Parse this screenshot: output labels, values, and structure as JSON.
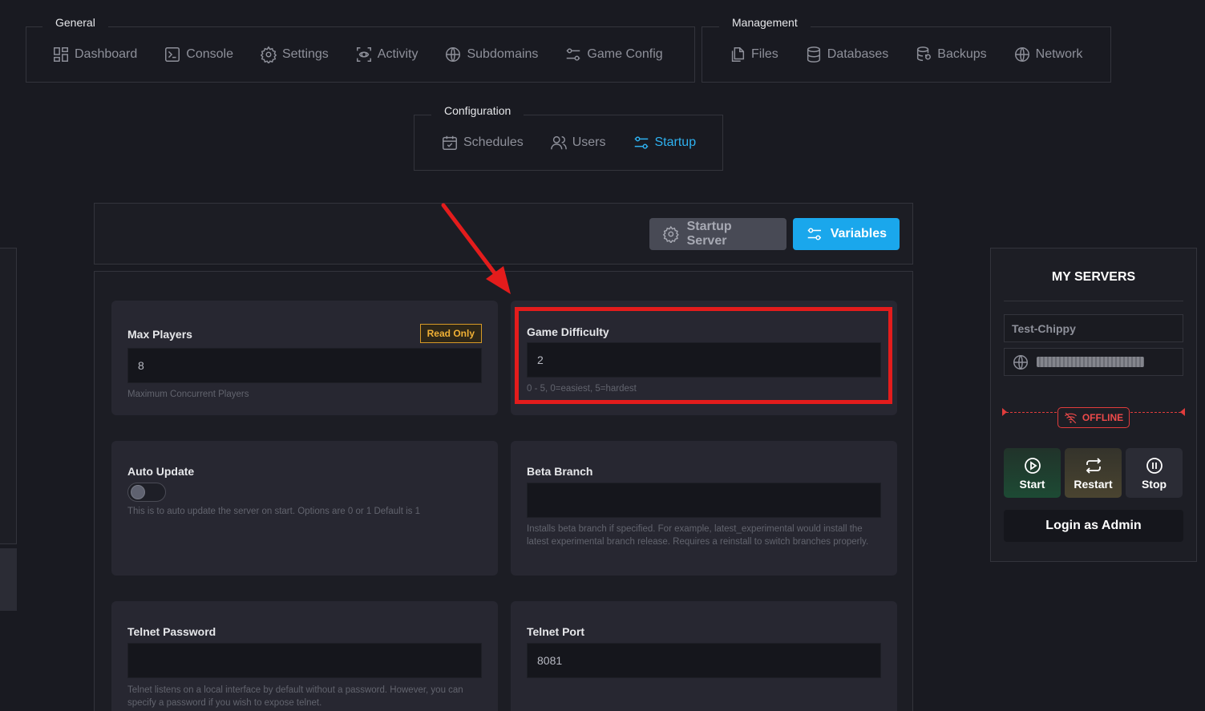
{
  "nav": {
    "general": {
      "legend": "General",
      "items": [
        {
          "label": "Dashboard",
          "icon": "dashboard-icon"
        },
        {
          "label": "Console",
          "icon": "console-icon"
        },
        {
          "label": "Settings",
          "icon": "gear-icon"
        },
        {
          "label": "Activity",
          "icon": "activity-icon"
        },
        {
          "label": "Subdomains",
          "icon": "globe-icon"
        },
        {
          "label": "Game Config",
          "icon": "sliders-icon"
        }
      ]
    },
    "management": {
      "legend": "Management",
      "items": [
        {
          "label": "Files",
          "icon": "files-icon"
        },
        {
          "label": "Databases",
          "icon": "database-icon"
        },
        {
          "label": "Backups",
          "icon": "backup-icon"
        },
        {
          "label": "Network",
          "icon": "globe-icon"
        }
      ]
    },
    "configuration": {
      "legend": "Configuration",
      "items": [
        {
          "label": "Schedules",
          "icon": "calendar-icon"
        },
        {
          "label": "Users",
          "icon": "users-icon"
        },
        {
          "label": "Startup",
          "icon": "sliders-icon",
          "active": true
        }
      ]
    }
  },
  "toolbar": {
    "startup_server_label": "Startup Server",
    "variables_label": "Variables"
  },
  "variables": {
    "max_players": {
      "title": "Max Players",
      "badge": "Read Only",
      "value": "8",
      "help": "Maximum Concurrent Players"
    },
    "game_difficulty": {
      "title": "Game Difficulty",
      "value": "2",
      "help": "0 - 5, 0=easiest, 5=hardest"
    },
    "auto_update": {
      "title": "Auto Update",
      "enabled": false,
      "help": "This is to auto update the server on start. Options are 0 or 1 Default is 1"
    },
    "beta_branch": {
      "title": "Beta Branch",
      "value": "",
      "help": "Installs beta branch if specified. For example, latest_experimental would install the latest experimental branch release. Requires a reinstall to switch branches properly."
    },
    "telnet_password": {
      "title": "Telnet Password",
      "value": "",
      "help": "Telnet listens on a local interface by default without a password. However, you can specify a password if you wish to expose telnet."
    },
    "telnet_port": {
      "title": "Telnet Port",
      "value": "8081",
      "help": ""
    }
  },
  "sidebar": {
    "title": "MY SERVERS",
    "server_name": "Test-Chippy",
    "status": "OFFLINE",
    "start_label": "Start",
    "restart_label": "Restart",
    "stop_label": "Stop",
    "login_label": "Login as Admin"
  },
  "colors": {
    "accent": "#1aa7ec",
    "highlight": "#e31c1c",
    "offline": "#ee4a4a",
    "badge": "#f0b035"
  }
}
